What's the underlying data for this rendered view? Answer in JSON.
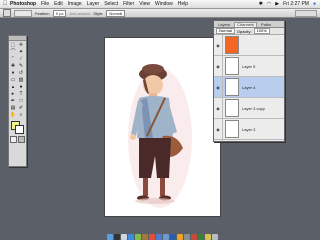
{
  "menubar": {
    "app_name": "Photoshop",
    "items": [
      "File",
      "Edit",
      "Image",
      "Layer",
      "Select",
      "Filter",
      "View",
      "Window",
      "Help"
    ],
    "clock": "Fri 2:27 PM",
    "bt_icon": "bluetooth-icon",
    "wifi_icon": "wifi-icon",
    "volume_icon": "volume-icon",
    "spotlight_icon": "search-icon"
  },
  "options_bar": {
    "feather_label": "Feather:",
    "feather_value": "0 px",
    "antialias_label": "Anti-aliased",
    "style_label": "Style:",
    "style_value": "Normal"
  },
  "toolbox": {
    "foreground_color": "#f3f28a",
    "background_color": "#ffffff"
  },
  "layers_panel": {
    "tabs": [
      "Layers",
      "Channels",
      "Paths"
    ],
    "blend_mode": "Normal",
    "opacity_label": "Opacity:",
    "opacity_value": "100%",
    "layers": [
      {
        "name": "",
        "thumb": "#f26522",
        "visible": true,
        "selected": false
      },
      {
        "name": "Layer 5",
        "thumb": "#ffffff",
        "visible": true,
        "selected": false
      },
      {
        "name": "Layer 4",
        "thumb": "#ffffff",
        "visible": true,
        "selected": true
      },
      {
        "name": "Layer 3 copy",
        "thumb": "#ffffff",
        "visible": true,
        "selected": false
      },
      {
        "name": "Layer 3",
        "thumb": "#ffffff",
        "visible": true,
        "selected": false
      },
      {
        "name": "",
        "thumb": "#f4544c",
        "visible": true,
        "selected": false
      }
    ]
  },
  "colors": {
    "desktop": "#5b6068",
    "canvas": "#ffffff",
    "accent_selected": "#b9cdee"
  }
}
